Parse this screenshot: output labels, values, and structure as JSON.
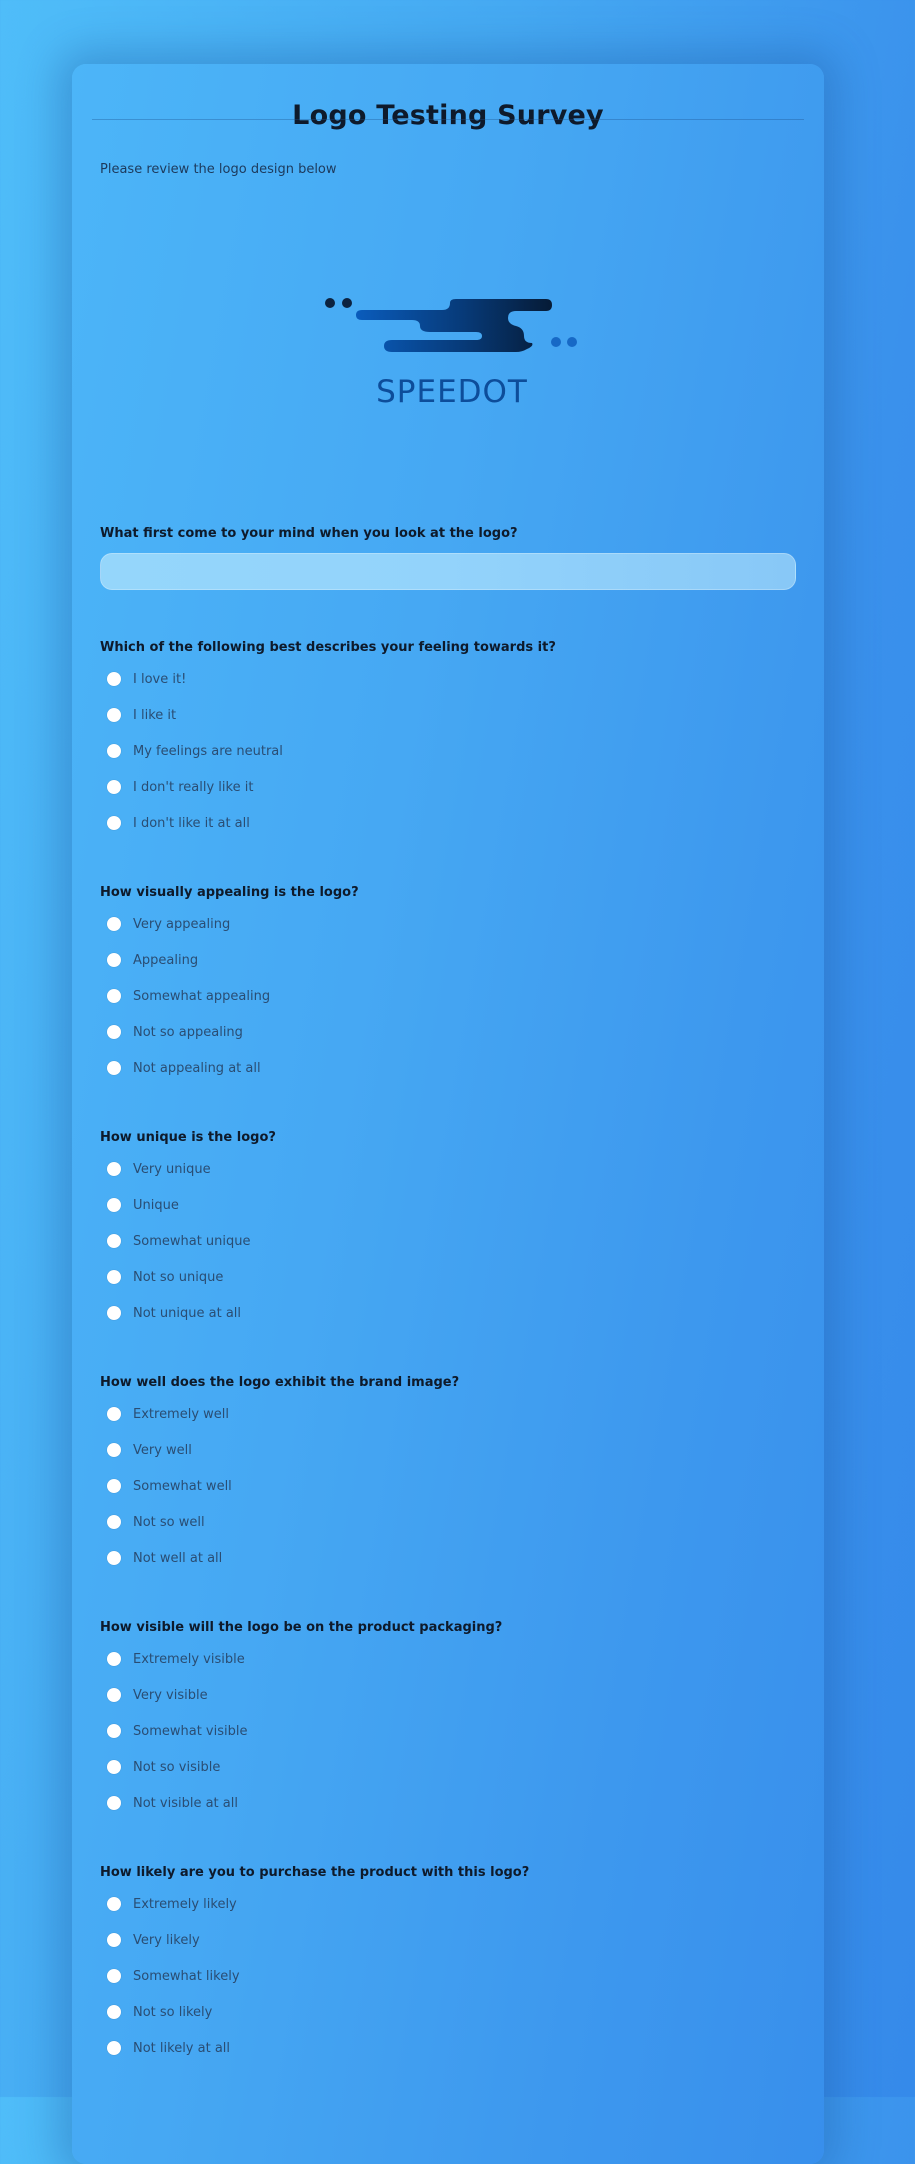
{
  "survey": {
    "title": "Logo Testing Survey",
    "intro": "Please review the logo design below",
    "logo": {
      "wordmark": "SPEEDOT",
      "icon": "speed-dash-logo-icon",
      "colors": {
        "dark": "#0b2446",
        "mid": "#0a5bb8",
        "light": "#1d6fd0",
        "dots": "#0c2340",
        "dots_light": "#1769c6"
      }
    },
    "text_question": {
      "label": "What first come to your mind when you look at the logo?",
      "value": "",
      "placeholder": ""
    },
    "questions": [
      {
        "label": "Which of the following best describes your feeling towards it?",
        "options": [
          "I love it!",
          "I like it",
          "My feelings are neutral",
          "I don't really like it",
          "I don't like it at all"
        ]
      },
      {
        "label": "How visually appealing is the logo?",
        "options": [
          "Very appealing",
          "Appealing",
          "Somewhat appealing",
          "Not so appealing",
          "Not appealing at all"
        ]
      },
      {
        "label": "How unique is the logo?",
        "options": [
          "Very unique",
          "Unique",
          "Somewhat unique",
          "Not so unique",
          "Not unique at all"
        ]
      },
      {
        "label": "How well does the logo exhibit the brand image?",
        "options": [
          "Extremely well",
          "Very well",
          "Somewhat well",
          "Not so well",
          "Not well at all"
        ]
      },
      {
        "label": "How visible will the logo be on the product packaging?",
        "options": [
          "Extremely visible",
          "Very visible",
          "Somewhat visible",
          "Not so visible",
          "Not visible at all"
        ]
      },
      {
        "label": "How likely are you to purchase the product with this logo?",
        "options": [
          "Extremely likely",
          "Very likely",
          "Somewhat likely",
          "Not so likely",
          "Not likely at all"
        ]
      }
    ]
  }
}
